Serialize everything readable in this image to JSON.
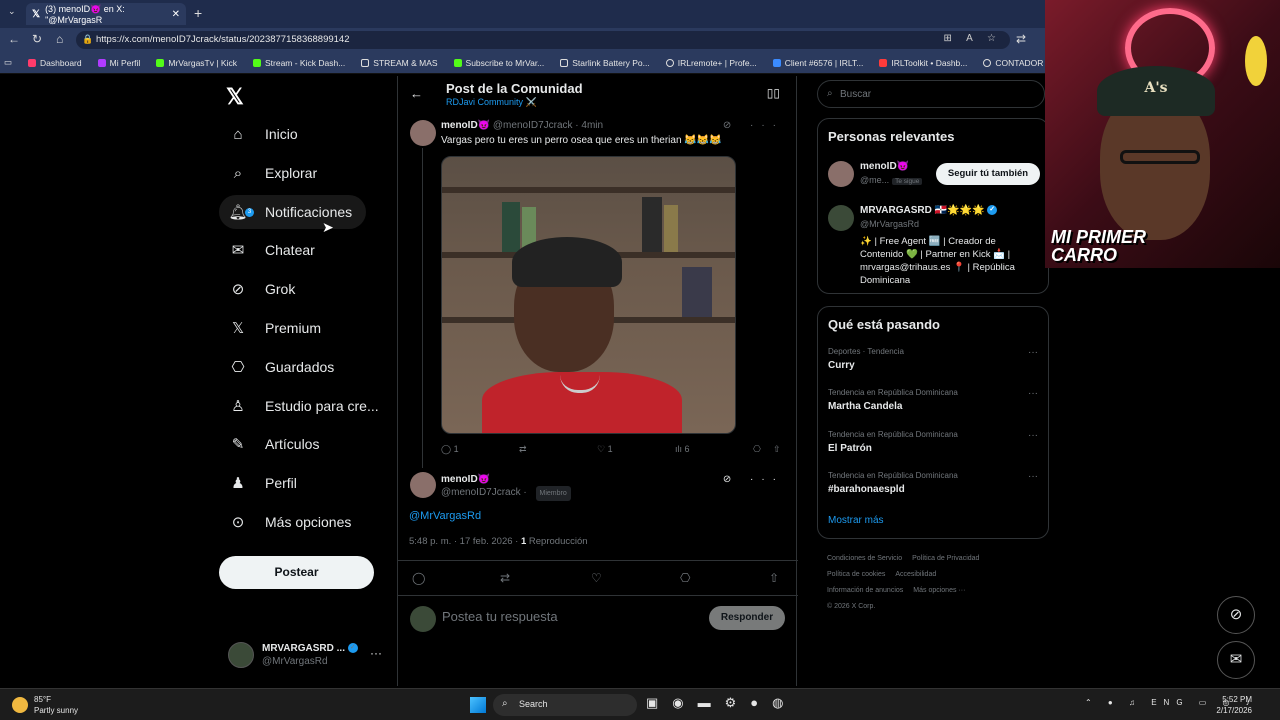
{
  "browser": {
    "tab_title": "(3) menoID😈 en X: \"@MrVargasR",
    "url": "https://x.com/menoID7Jcrack/status/2023877158368899142",
    "bookmarks": [
      "Dashboard",
      "Mi Perfil",
      "MrVargasTv | Kick",
      "Stream - Kick Dash...",
      "STREAM & MAS",
      "Subscribe to MrVar...",
      "Starlink Battery Po...",
      "IRLremote+ | Profe...",
      "Client #6576 | IRLT...",
      "IRLToolkit • Dashb...",
      "CONTADOR"
    ]
  },
  "nav": {
    "items": [
      {
        "label": "Inicio",
        "icon": "home-icon"
      },
      {
        "label": "Explorar",
        "icon": "search-icon"
      },
      {
        "label": "Notificaciones",
        "icon": "bell-icon"
      },
      {
        "label": "Chatear",
        "icon": "mail-icon"
      },
      {
        "label": "Grok",
        "icon": "grok-icon"
      },
      {
        "label": "Premium",
        "icon": "x-icon"
      },
      {
        "label": "Guardados",
        "icon": "bookmark-icon"
      },
      {
        "label": "Estudio para cre...",
        "icon": "studio-icon"
      },
      {
        "label": "Artículos",
        "icon": "article-icon"
      },
      {
        "label": "Perfil",
        "icon": "person-icon"
      },
      {
        "label": "Más opciones",
        "icon": "more-icon"
      }
    ],
    "badge": "3",
    "post_button": "Postear",
    "profile_name": "MRVARGASRD ...",
    "profile_handle": "@MrVargasRd"
  },
  "header": {
    "title": "Post de la Comunidad",
    "subtitle": "RDJavi Community ⚔️"
  },
  "tweet1": {
    "name": "menoID😈",
    "handle": "@menoID7Jcrack · 4min",
    "text": "Vargas pero tu eres un perro osea que eres un therian 😹😹😹",
    "replies": "1",
    "likes": "1",
    "views": "6"
  },
  "tweet2": {
    "name": "menoID😈",
    "handle": "@menoID7Jcrack ·",
    "member_tag": "Miembro",
    "text": "@MrVargasRd",
    "time": "5:48 p. m. · 17 feb. 2026 ·",
    "plays_count": "1",
    "plays_label": "Reproducción"
  },
  "reply": {
    "placeholder": "Postea tu respuesta",
    "button": "Responder"
  },
  "right": {
    "search_placeholder": "Buscar",
    "relevant_title": "Personas relevantes",
    "person1_name": "menoID😈",
    "person1_handle": "@me...",
    "person1_tag": "Te sigue",
    "follow_button": "Seguir tú también",
    "person2_name": "MRVARGASRD 🇩🇴🌟🌟🌟",
    "person2_handle": "@MrVargasRd",
    "person2_bio": "✨ | Free Agent 🆓 | Creador de Contenido 💚 | Partner en Kick 📩 | mrvargas@trihaus.es 📍 | República Dominicana",
    "trends_title": "Qué está pasando",
    "trends": [
      {
        "context": "Deportes · Tendencia",
        "name": "Curry"
      },
      {
        "context": "Tendencia en República Dominicana",
        "name": "Martha Candela"
      },
      {
        "context": "Tendencia en República Dominicana",
        "name": "El Patrón"
      },
      {
        "context": "Tendencia en República Dominicana",
        "name": "#barahonaespld"
      }
    ],
    "show_more": "Mostrar más",
    "footer": [
      "Condiciones de Servicio",
      "Política de Privacidad",
      "Política de cookies",
      "Accesibilidad",
      "Información de anuncios",
      "Más opciones ···",
      "© 2026 X Corp."
    ]
  },
  "cam": {
    "hat_text": "A's",
    "banner_line1": "MI PRIMER",
    "banner_line2": "CARRO"
  },
  "taskbar": {
    "temp": "85°F",
    "weather": "Partly sunny",
    "search": "Search",
    "lang": "ENG",
    "time": "5:52 PM",
    "date": "2/17/2026"
  }
}
